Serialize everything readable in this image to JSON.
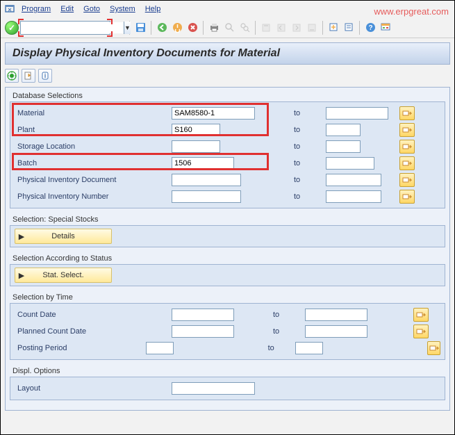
{
  "watermark": "www.erpgreat.com",
  "menu": {
    "program": "Program",
    "edit": "Edit",
    "goto": "Goto",
    "system": "System",
    "help": "Help"
  },
  "toolbar": {
    "command": ""
  },
  "title": "Display Physical Inventory Documents for Material",
  "labels": {
    "to": "to"
  },
  "groups": {
    "db": {
      "title": "Database Selections",
      "rows": [
        {
          "label": "Material",
          "from": "SAM8580-1",
          "to": ""
        },
        {
          "label": "Plant",
          "from": "S160",
          "to": ""
        },
        {
          "label": "Storage Location",
          "from": "",
          "to": ""
        },
        {
          "label": "Batch",
          "from": "1506",
          "to": ""
        },
        {
          "label": "Physical Inventory Document",
          "from": "",
          "to": ""
        },
        {
          "label": "Physical Inventory Number",
          "from": "",
          "to": ""
        }
      ]
    },
    "special": {
      "title": "Selection: Special Stocks",
      "button": "Details"
    },
    "status": {
      "title": "Selection According to Status",
      "button": "Stat. Select."
    },
    "time": {
      "title": "Selection by Time",
      "rows": [
        {
          "label": "Count Date",
          "from": "",
          "to": ""
        },
        {
          "label": "Planned Count Date",
          "from": "",
          "to": ""
        },
        {
          "label": "Posting Period",
          "from": "",
          "to": ""
        }
      ]
    },
    "displ": {
      "title": "Displ. Options",
      "rows": [
        {
          "label": "Layout",
          "value": ""
        }
      ]
    }
  }
}
